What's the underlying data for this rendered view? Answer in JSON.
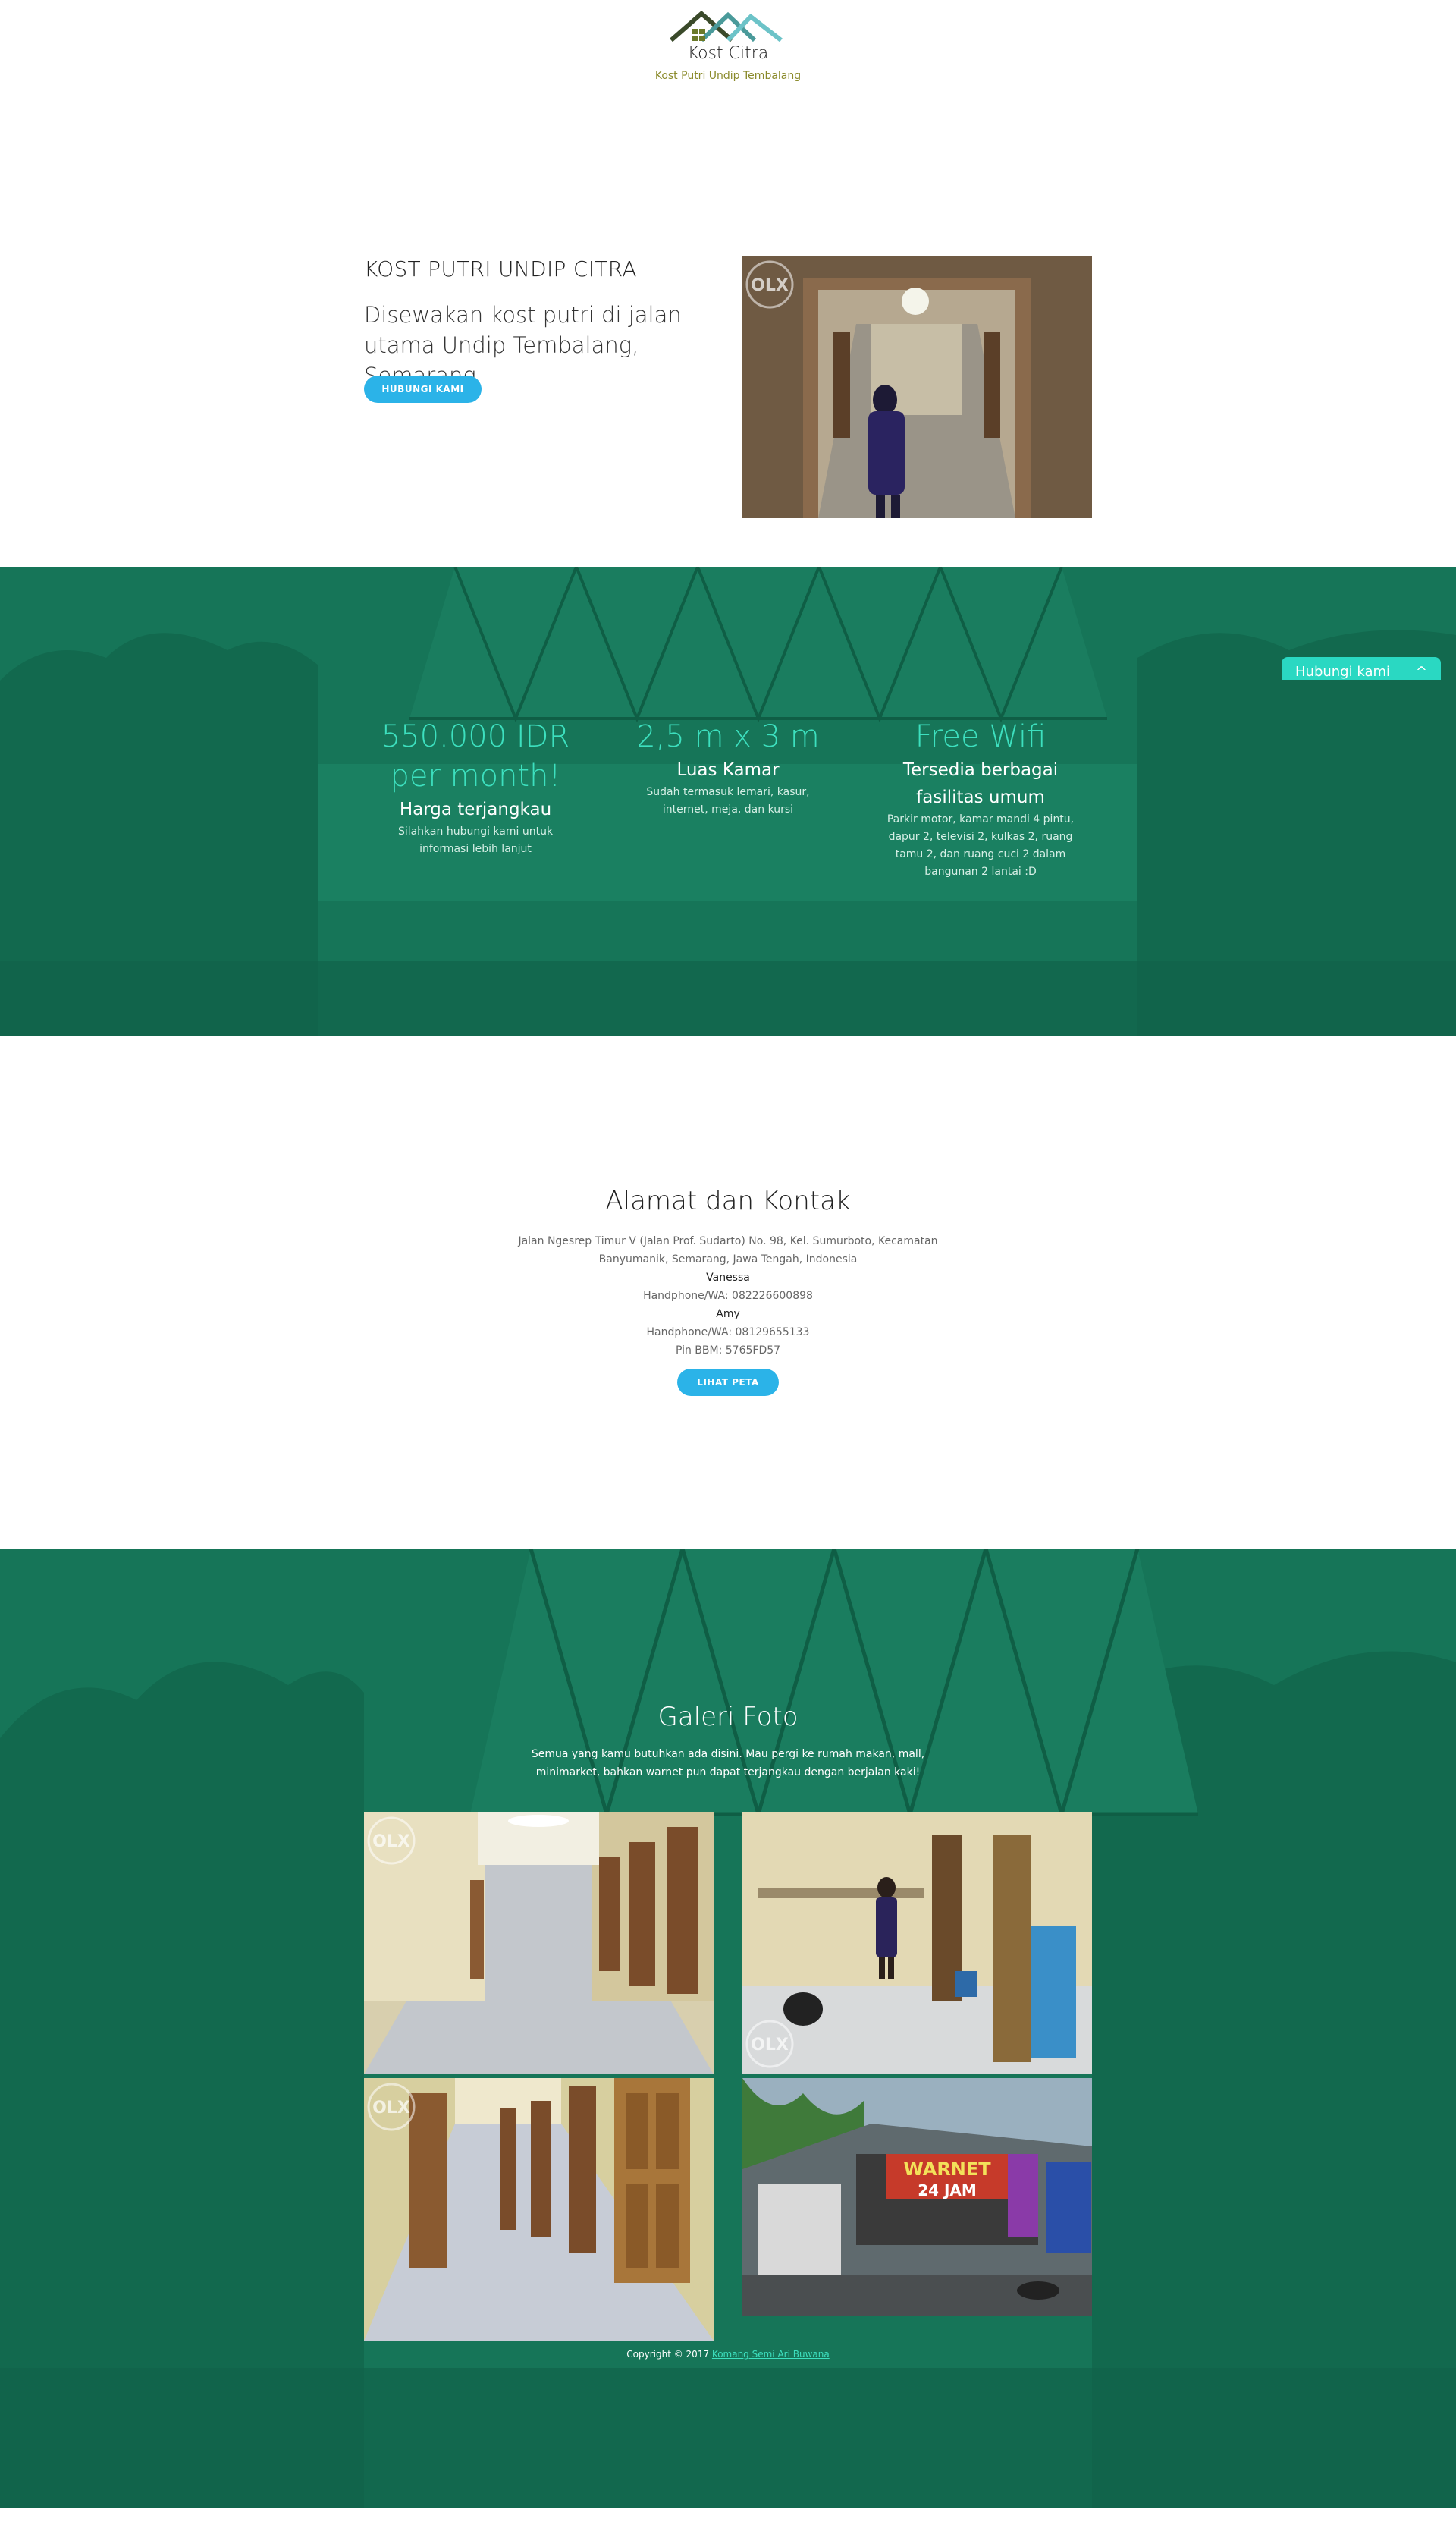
{
  "header": {
    "brand_name": "Kost Citra",
    "tagline": "Kost Putri Undip Tembalang"
  },
  "hero": {
    "title": "KOST PUTRI UNDIP CITRA",
    "subtitle": "Disewakan kost putri di jalan utama Undip Tembalang, Semarang",
    "button_label": "HUBUNGI KAMI",
    "photo_watermark": "OLX"
  },
  "features": [
    {
      "big": "550.000 IDR per month!",
      "title": "Harga terjangkau",
      "text": "Silahkan hubungi kami untuk informasi lebih lanjut"
    },
    {
      "big": "2,5 m x 3 m",
      "title": "Luas Kamar",
      "text": "Sudah termasuk lemari, kasur, internet, meja, dan kursi"
    },
    {
      "big": "Free Wifi",
      "title": "Tersedia berbagai fasilitas umum",
      "text": "Parkir motor, kamar mandi 4 pintu, dapur 2, televisi 2, kulkas 2, ruang tamu 2, dan ruang cuci 2 dalam bangunan 2 lantai :D"
    }
  ],
  "chat": {
    "label": "Hubungi kami",
    "chevron": "^"
  },
  "address": {
    "title": "Alamat dan Kontak",
    "street": "Jalan Ngesrep Timur V (Jalan Prof. Sudarto) No. 98, Kel. Sumurboto, Kecamatan Banyumanik, Semarang, Jawa Tengah, Indonesia",
    "contact1_name": "Vanessa",
    "contact1_phone": "Handphone/WA: 082226600898",
    "contact2_name": "Amy",
    "contact2_phone": "Handphone/WA: 08129655133",
    "contact2_pin": "Pin BBM: 5765FD57",
    "button_label": "LIHAT PETA"
  },
  "gallery": {
    "title": "Galeri Foto",
    "description": "Semua yang kamu butuhkan ada disini. Mau pergi ke rumah makan, mall, minimarket, bahkan warnet pun dapat terjangkau dengan berjalan kaki!",
    "watermark": "OLX",
    "banner_text_1": "WARNET",
    "banner_text_2": "24 JAM"
  },
  "footer": {
    "copyright": "Copyright © 2017",
    "author": "Komang Semi Ari Buwana"
  },
  "colors": {
    "green": "#167558",
    "accent_teal": "#3de0bf",
    "button_blue": "#2bb3e8",
    "chat_tab": "#2ad8c2"
  }
}
